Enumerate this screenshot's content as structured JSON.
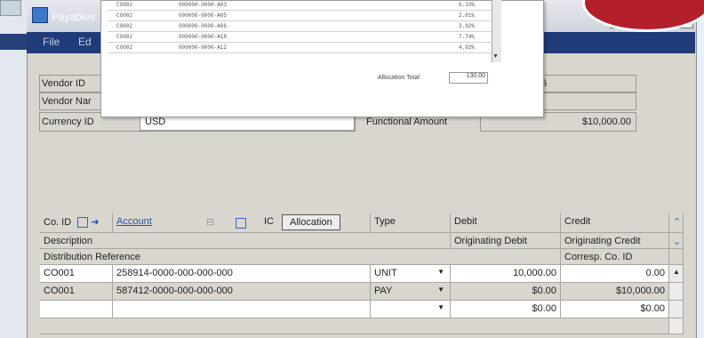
{
  "window": {
    "title": "Payables",
    "buttons": [
      "_",
      "□",
      "✕"
    ]
  },
  "menu": [
    "File",
    "Ed"
  ],
  "popup": {
    "rows": [
      [
        "CO002",
        "000000-0000-A03",
        "6.33%"
      ],
      [
        "CO002",
        "000000-0000-A05",
        "2.81%"
      ],
      [
        "CO002",
        "000000-0000-A06",
        "3.92%"
      ],
      [
        "CO002",
        "000000-0000-A18",
        "7.74%"
      ],
      [
        "CO002",
        "000000-0000-A12",
        "4.02%"
      ]
    ],
    "allocation_total_label": "Allocation Total",
    "allocation_total_value": "130.00"
  },
  "header": {
    "vendor_id_label": "Vendor ID",
    "vendor_name_label": "Vendor Nar",
    "currency_id_label": "Currency ID",
    "currency_id_value": "USD",
    "right_fragment": "6",
    "functional_amount_label": "Functional Amount",
    "functional_amount_value": "$10,000.00"
  },
  "grid": {
    "header_row1": {
      "co_id": "Co. ID",
      "account": "Account",
      "ic": "IC",
      "allocation_button": "Allocation",
      "type": "Type",
      "debit": "Debit",
      "credit": "Credit"
    },
    "header_row2": {
      "description": "Description",
      "originating_debit": "Originating Debit",
      "originating_credit": "Originating Credit"
    },
    "header_row3": {
      "distribution_reference": "Distribution Reference",
      "corresp_co_id": "Corresp. Co. ID"
    },
    "rows": [
      {
        "co_id": "CO001",
        "account": "258914-0000-000-000-000",
        "type": "UNIT",
        "debit": "10,000.00",
        "credit": "0.00"
      },
      {
        "co_id": "CO001",
        "account": "587412-0000-000-000-000",
        "type": "PAY",
        "debit": "$0.00",
        "credit": "$10,000.00"
      },
      {
        "co_id": "",
        "account": "",
        "type": "",
        "debit": "$0.00",
        "credit": "$0.00"
      }
    ]
  }
}
